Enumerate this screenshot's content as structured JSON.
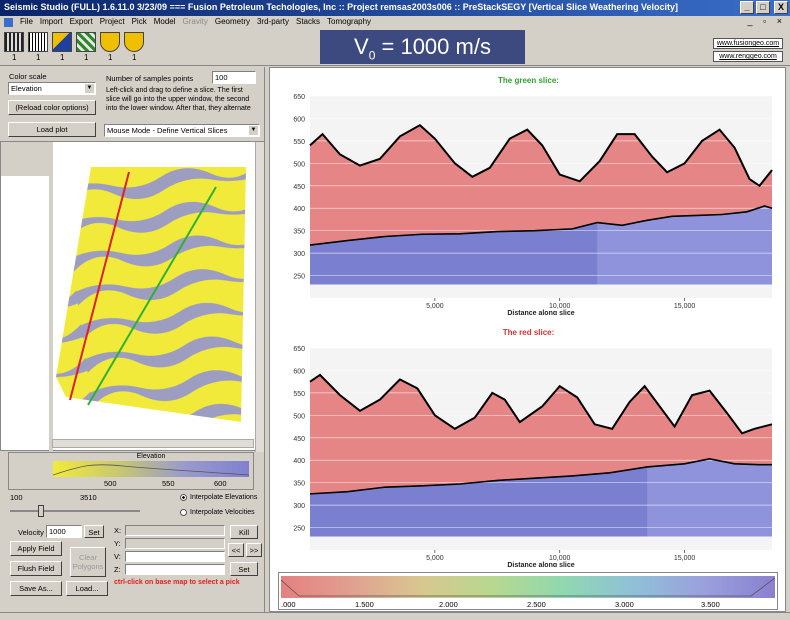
{
  "window": {
    "title": "Seismic Studio (FULL) 1.6.11.0 3/23/09 === Fusion Petroleum Techologies, Inc  :: Project remsas2003s006 :: PreStackSEGY  [Vertical Slice Weathering Velocity]",
    "min": "_",
    "max": "□",
    "close": "X"
  },
  "menu": [
    "File",
    "Import",
    "Export",
    "Project",
    "Pick",
    "Model",
    "Gravity",
    "Geometry",
    "3rd-party",
    "Stacks",
    "Tomography"
  ],
  "mdi_controls": "_ ▫ ×",
  "toolbar_counts": [
    "1",
    "1",
    "1",
    "1",
    "1",
    "1"
  ],
  "overlay": {
    "v0_label": "V",
    "v0_sub": "0",
    "v0_value": " = 1000 m/s"
  },
  "links": [
    "www.fusiongeo.com",
    "www.renggeo.com"
  ],
  "left": {
    "color_scale_label": "Color scale",
    "color_scale_value": "Elevation",
    "samples_label": "Number of samples points",
    "samples_value": "100",
    "instructions": "Left-click and drag to define a slice. The first slice will go into the upper window, the second into the lower window. After that, they alternate",
    "reload_btn": "(Reload color options)",
    "load_plot_btn": "Load plot",
    "mouse_mode": "Mouse Mode - Define Vertical Slices",
    "colorbar_title": "Elevation",
    "colorbar_ticks": [
      "500",
      "550",
      "600"
    ],
    "range_min": "100",
    "range_max": "3510",
    "radio_elev": "Interpolate Elevations",
    "radio_vel": "Interpolate Velocities",
    "velocity_label": "Velocity",
    "velocity_value": "1000",
    "set_btn": "Set",
    "apply_btn": "Apply Field",
    "clear_btn_1": "Clear",
    "clear_btn_2": "Polygons",
    "flush_btn": "Flush Field",
    "save_btn": "Save As...",
    "load_btn": "Load...",
    "xyz_labels": [
      "X:",
      "Y:",
      "V:",
      "Z:"
    ],
    "kill_btn": "Kill",
    "prev_btn": "<<",
    "next_btn": ">>",
    "set2_btn": "Set",
    "hint": "ctrl-click on base map to select a pick"
  },
  "bottom_colorbar": {
    "ticks": [
      ".000",
      "1.500",
      "2.000",
      "2.500",
      "3.000",
      "3.500"
    ]
  },
  "chart_data": [
    {
      "type": "area",
      "title": "The green slice:",
      "title_color": "#30a030",
      "xlabel": "Distance along slice",
      "ylabel": "",
      "xlim": [
        0,
        18500
      ],
      "ylim": [
        200,
        650
      ],
      "yticks": [
        "250",
        "300",
        "350",
        "400",
        "450",
        "500",
        "550",
        "600",
        "650"
      ],
      "xticks": [
        {
          "v": 5000,
          "label": "5,000"
        },
        {
          "v": 10000,
          "label": "10,000"
        },
        {
          "v": 15000,
          "label": "15,000"
        }
      ],
      "surface": [
        [
          0,
          540
        ],
        [
          500,
          565
        ],
        [
          1200,
          520
        ],
        [
          2000,
          495
        ],
        [
          2800,
          510
        ],
        [
          3600,
          560
        ],
        [
          4400,
          585
        ],
        [
          5000,
          555
        ],
        [
          5800,
          500
        ],
        [
          6500,
          470
        ],
        [
          7200,
          490
        ],
        [
          8000,
          555
        ],
        [
          8700,
          575
        ],
        [
          9300,
          540
        ],
        [
          10000,
          475
        ],
        [
          10800,
          460
        ],
        [
          11600,
          505
        ],
        [
          12300,
          565
        ],
        [
          13000,
          565
        ],
        [
          13700,
          515
        ],
        [
          14300,
          480
        ],
        [
          15000,
          500
        ],
        [
          15700,
          550
        ],
        [
          16400,
          575
        ],
        [
          17000,
          535
        ],
        [
          17600,
          465
        ],
        [
          18000,
          450
        ],
        [
          18500,
          485
        ]
      ],
      "weathering_base": [
        [
          0,
          318
        ],
        [
          1500,
          328
        ],
        [
          3000,
          337
        ],
        [
          4500,
          342
        ],
        [
          6000,
          343
        ],
        [
          7500,
          348
        ],
        [
          9000,
          350
        ],
        [
          10500,
          354
        ],
        [
          11500,
          368
        ],
        [
          12500,
          362
        ],
        [
          13500,
          373
        ],
        [
          14500,
          382
        ],
        [
          15500,
          384
        ],
        [
          16500,
          386
        ],
        [
          17500,
          392
        ],
        [
          18200,
          405
        ],
        [
          18500,
          400
        ]
      ],
      "split_x": 11500
    },
    {
      "type": "area",
      "title": "The red slice:",
      "title_color": "#e03030",
      "xlabel": "Distance along slice",
      "ylabel": "",
      "xlim": [
        0,
        18500
      ],
      "ylim": [
        200,
        650
      ],
      "yticks": [
        "250",
        "300",
        "350",
        "400",
        "450",
        "500",
        "550",
        "600",
        "650"
      ],
      "xticks": [
        {
          "v": 5000,
          "label": "5,000"
        },
        {
          "v": 10000,
          "label": "10,000"
        },
        {
          "v": 15000,
          "label": "15,000"
        }
      ],
      "surface": [
        [
          0,
          575
        ],
        [
          400,
          590
        ],
        [
          1200,
          545
        ],
        [
          2000,
          510
        ],
        [
          2800,
          535
        ],
        [
          3600,
          580
        ],
        [
          4300,
          560
        ],
        [
          5000,
          500
        ],
        [
          5800,
          470
        ],
        [
          6600,
          495
        ],
        [
          7300,
          550
        ],
        [
          7800,
          535
        ],
        [
          8400,
          485
        ],
        [
          9300,
          520
        ],
        [
          10000,
          565
        ],
        [
          10700,
          540
        ],
        [
          11400,
          480
        ],
        [
          12100,
          470
        ],
        [
          12800,
          530
        ],
        [
          13400,
          565
        ],
        [
          14000,
          520
        ],
        [
          14600,
          475
        ],
        [
          15300,
          545
        ],
        [
          16000,
          555
        ],
        [
          16700,
          505
        ],
        [
          17300,
          460
        ],
        [
          17800,
          470
        ],
        [
          18500,
          480
        ]
      ],
      "weathering_base": [
        [
          0,
          325
        ],
        [
          1500,
          330
        ],
        [
          3000,
          340
        ],
        [
          4500,
          343
        ],
        [
          6000,
          347
        ],
        [
          7500,
          355
        ],
        [
          9000,
          360
        ],
        [
          10500,
          365
        ],
        [
          12000,
          372
        ],
        [
          13500,
          385
        ],
        [
          15000,
          392
        ],
        [
          16000,
          403
        ],
        [
          17000,
          392
        ],
        [
          18000,
          390
        ],
        [
          18500,
          390
        ]
      ],
      "split_x": 13500
    }
  ]
}
